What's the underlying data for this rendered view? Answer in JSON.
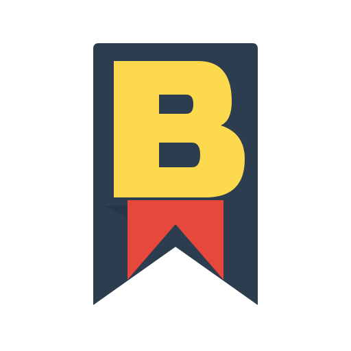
{
  "logo": {
    "letter": "B",
    "colors": {
      "badge": "#2d3d50",
      "letter": "#fdd94d",
      "ribbon": "#e6493b",
      "background": "#ffffff"
    },
    "icon": "bookmark-badge-icon"
  }
}
